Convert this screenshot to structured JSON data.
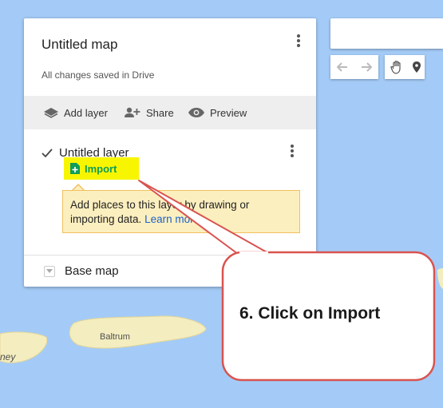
{
  "map": {
    "labels": {
      "island": "Baltrum",
      "partial_place": "ney"
    }
  },
  "panel": {
    "title": "Untitled map",
    "save_status": "All changes saved in Drive",
    "toolbar": {
      "add_layer": "Add layer",
      "share": "Share",
      "preview": "Preview"
    },
    "layer": {
      "name": "Untitled layer",
      "checked": true,
      "import_label": "Import"
    },
    "tooltip": {
      "text": "Add places to this layer by drawing or importing data.",
      "link": "Learn more"
    },
    "base_map_label": "Base map"
  },
  "map_tools": {
    "icons": [
      "undo-icon",
      "redo-icon",
      "pan-hand-icon",
      "marker-icon"
    ]
  },
  "callout": {
    "text": "6. Click on Import",
    "border_color": "#d9534f",
    "highlight_color": "#f7f500"
  }
}
